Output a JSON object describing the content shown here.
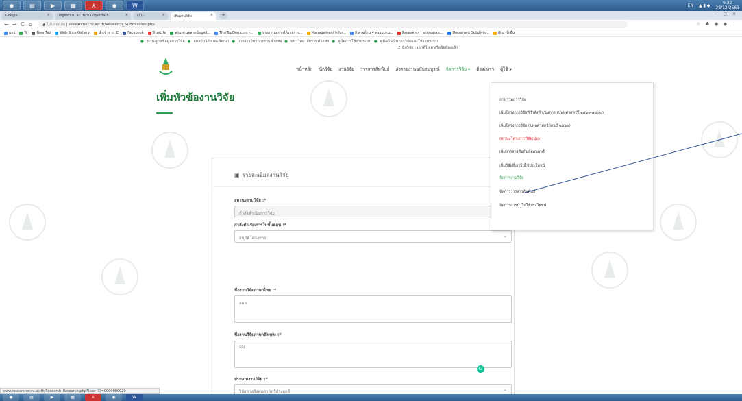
{
  "taskbar": {
    "apps": [
      "chrome-icon",
      "folder-icon",
      "media-icon",
      "notepad-icon",
      "pdf-icon",
      "chrome-icon-2",
      "word-icon"
    ],
    "tray": {
      "lang": "EN",
      "time": "9:32",
      "date": "28/12/2563"
    }
  },
  "browser": {
    "tabs": [
      {
        "label": "Google"
      },
      {
        "label": "loginm.ru.ac.th/1000/portal?"
      },
      {
        "label": "(1) -"
      },
      {
        "label": "เพิ่มงานวิจัย"
      }
    ],
    "address": {
      "warning": "ไม่ปลอดภัย",
      "url": "researcher.ru.ac.th/Research_Submission.php"
    },
    "bookmarks": [
      "แอป",
      "W",
      "New Tab",
      "Web Slice Gallery",
      "นำเข้าจาก IE",
      "Facebook",
      "TrueLife",
      "พรมทานตลาดข้อมูลอั...",
      "ThaiTopDog.com -...",
      "รายการผลการได้รายการ...",
      "Management Infor...",
      "8 สายด้าน 4 ครอบบาน...",
      "สิ่งของต่างๆ | winnapa.c...",
      "Document Subdivis...",
      "บุ๊กมาร์กอื่น"
    ]
  },
  "site": {
    "topinfo": [
      "ระบบฐานข้อมูลการวิจัย",
      "สถาบันวิจัยและพัฒนา",
      "วารสารวิชาการรามคำแหง",
      "มหาวิทยาลัยรามคำแหง",
      "คู่มือการใช้งานระบบ",
      "คู่มือดำเนินการวิจัยและใช้งานระบบ"
    ],
    "user": "นักวิจัย : เอกพีไล ผาเรียลุ้ยหัดอเล้า",
    "nav": [
      "หน้าหลัก",
      "นักวิจัย",
      "งานวิจัย",
      "วารสารสัมพันธ์",
      "ส่งรายงานฉบับสมบูรณ์",
      "จัดการวิจัย ▾",
      "ติดต่อเรา",
      "ผู้ใช้ ▾"
    ],
    "page_title": "เพิ่มหัวข้องานวิจัย"
  },
  "dropdown": {
    "items": [
      {
        "label": "ภาพรวมการวิจัย",
        "style": "normal"
      },
      {
        "label": "เพิ่มโครงการวิจัยที่กำลังดำเนินการ (ปุพพศาสตร์ปี ๒๕๖๐-๒๕๖๓)",
        "style": "normal"
      },
      {
        "label": "เพิ่มโครงการวิจัย (ปุพพศาสตร์ก่อนปี ๒๕๖๐)",
        "style": "normal"
      },
      {
        "label": "สถานะโครงการวิจัย(ปุ่ม)",
        "style": "red"
      },
      {
        "label": "เพิ่มวารสารสัมพันธ์ออนแพร์",
        "style": "normal"
      },
      {
        "label": "เพิ่มวิจัยที่เอาไปใช้ประโยชน์",
        "style": "normal"
      },
      {
        "label": "จัดการงานวิจัย",
        "style": "green"
      },
      {
        "label": "จัดการวารสารสัมพันธ์",
        "style": "normal"
      },
      {
        "label": "จัดการการนำไปใช้ประโยชน์",
        "style": "normal"
      }
    ]
  },
  "form": {
    "heading": "รายละเอียดงานวิจัย",
    "status_label": "สถานะงานวิจัย :*",
    "status_value": "กำลังดำเนินการวิจัย",
    "stage_label": "กำลังดำเนินการในขั้นตอน :*",
    "stage_value": "อนุมัติโครงการ",
    "title_th_label": "ชื่องานวิจัยภาษาไทย :*",
    "title_th_value": "ลลล",
    "title_en_label": "ชื่องานวิจัยภาษาอังกฤษ :*",
    "title_en_value": "sss",
    "type_label": "ประเภทงานวิจัย :*",
    "type_value": "วิจัยทางสังคมศาสตร์ประยุกต์"
  },
  "status_bar": "www.researcher.ru.ac.th/Research_Research.php?User_ID=0000000029",
  "colors": {
    "accent_green": "#2e9e4f",
    "title_green": "#1e7c3a",
    "red": "#e53935",
    "taskbar": "#2d5c8c"
  }
}
